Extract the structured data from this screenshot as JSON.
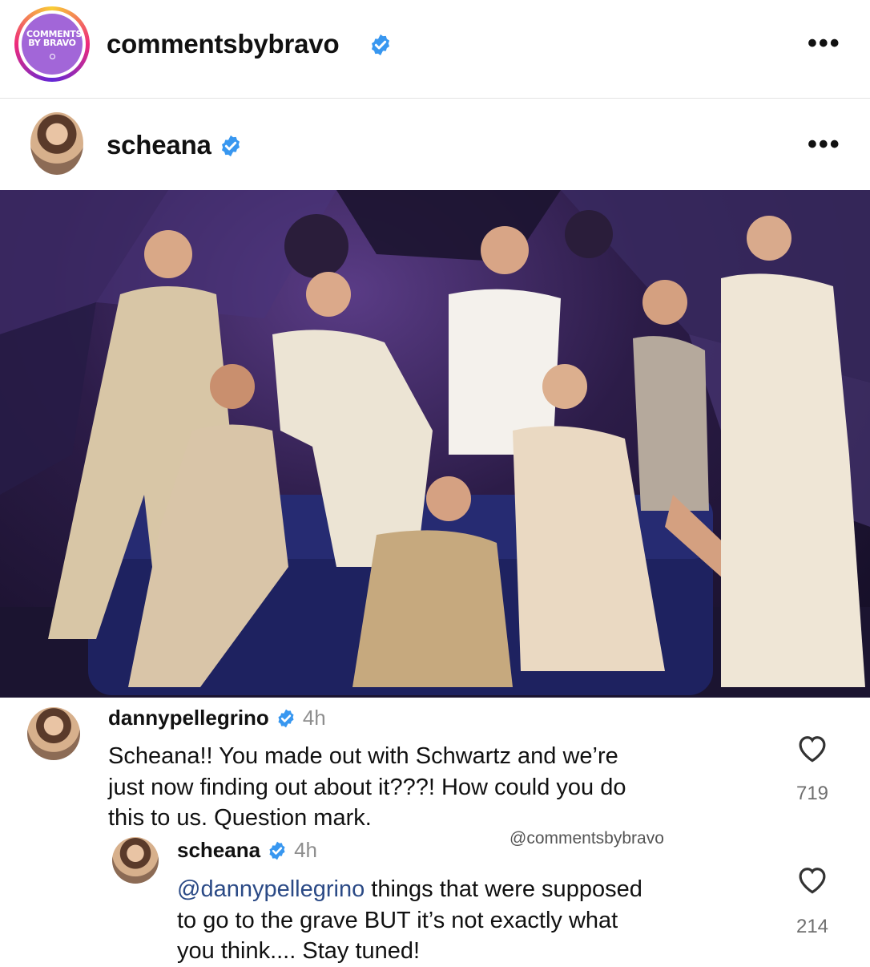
{
  "header": {
    "avatar_text": "COMMENTS BY BRAVO",
    "username": "commentsbybravo",
    "more_icon": "more-horizontal-icon"
  },
  "post": {
    "author": "scheana",
    "image_alt": "Vanderpump Rules cast photo on a blue sofa"
  },
  "comments": [
    {
      "user": "dannypellegrino",
      "time": "4h",
      "lines": [
        "Scheana!! You made out with Schwartz and we’re",
        "just now finding out about it???! How could you do",
        "this to us. Question mark."
      ],
      "likes": "719"
    },
    {
      "user": "scheana",
      "time": "4h",
      "mention": "@dannypellegrino",
      "line1_rest": " things that were supposed",
      "lines": [
        "to go to the grave BUT it’s not exactly what",
        "you think.... Stay tuned!"
      ],
      "likes": "214"
    }
  ],
  "watermark": "@commentsbybravo",
  "colors": {
    "verified": "#3897f0",
    "mention": "#2b4a86",
    "logo_bg": "#a266d8"
  }
}
